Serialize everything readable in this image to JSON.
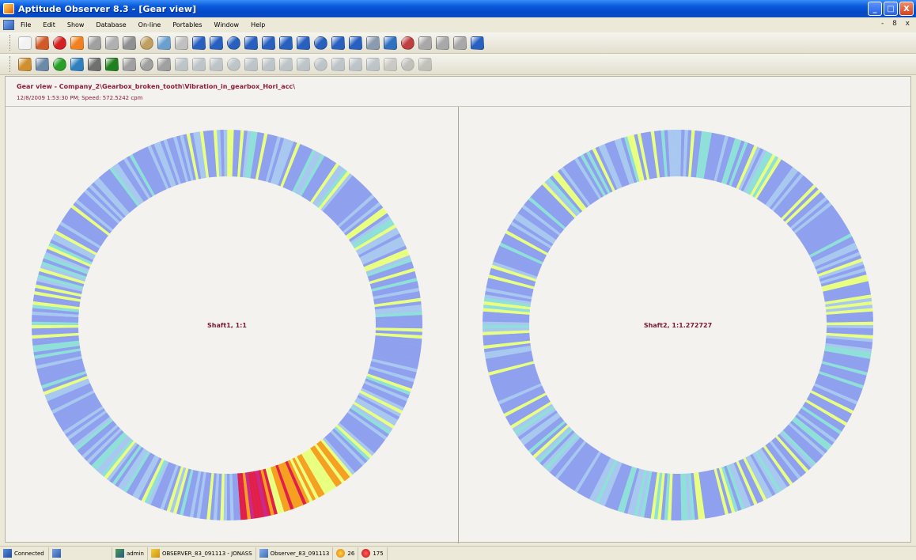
{
  "window": {
    "title": "Aptitude Observer 8.3 - [Gear view]",
    "controls": [
      "_",
      "□",
      "X"
    ]
  },
  "menu": {
    "items": [
      "File",
      "Edit",
      "Show",
      "Database",
      "On-line",
      "Portables",
      "Window",
      "Help"
    ],
    "mdi_controls": "- 8 x"
  },
  "toolbar1": {
    "buttons": [
      {
        "name": "new-doc-icon",
        "color": "#f2f2f2"
      },
      {
        "name": "edit-icon",
        "color": "#d25a2a"
      },
      {
        "name": "alarm-red-icon",
        "color": "#d42020"
      },
      {
        "name": "alarm-orange-icon",
        "color": "#f08020"
      },
      {
        "name": "tools-icon",
        "color": "#a0a0a0"
      },
      {
        "name": "gear-icon",
        "color": "#b0b0b0"
      },
      {
        "name": "gear2-icon",
        "color": "#909090"
      },
      {
        "name": "machine-icon",
        "color": "#c0a060"
      },
      {
        "name": "chart-icon",
        "color": "#6aa0d0"
      },
      {
        "name": "stopwatch-icon",
        "color": "#c0c0c0"
      },
      {
        "name": "trend-icon",
        "color": "#2860c0"
      },
      {
        "name": "wave-icon",
        "color": "#2860c0"
      },
      {
        "name": "spectrum-icon",
        "color": "#2860c0"
      },
      {
        "name": "list-icon",
        "color": "#2860c0"
      },
      {
        "name": "zoom-icon",
        "color": "#2860c0"
      },
      {
        "name": "cross-icon",
        "color": "#2860c0"
      },
      {
        "name": "orbit-icon",
        "color": "#2860c0"
      },
      {
        "name": "polar-icon",
        "color": "#2860c0"
      },
      {
        "name": "circle-icon",
        "color": "#2860c0"
      },
      {
        "name": "line-icon",
        "color": "#2860c0"
      },
      {
        "name": "waterfall-icon",
        "color": "#8a9ab0"
      },
      {
        "name": "map-icon",
        "color": "#3070c0"
      },
      {
        "name": "bar-icon",
        "color": "#c04040"
      },
      {
        "name": "grey1-icon",
        "color": "#a8a8a8"
      },
      {
        "name": "grey2-icon",
        "color": "#a8a8a8"
      },
      {
        "name": "grey3-icon",
        "color": "#a8a8a8"
      },
      {
        "name": "down-icon",
        "color": "#2860c0"
      }
    ]
  },
  "toolbar2": {
    "buttons": [
      {
        "name": "tree-icon",
        "color": "#d09030"
      },
      {
        "name": "trend-small-icon",
        "color": "#6a8aa8"
      },
      {
        "name": "globe-icon",
        "color": "#28a028"
      },
      {
        "name": "globe2-icon",
        "color": "#3080c0"
      },
      {
        "name": "stack-icon",
        "color": "#707070"
      },
      {
        "name": "recycle-icon",
        "color": "#208020"
      },
      {
        "name": "stopwatch2-icon",
        "color": "#a0a0a0"
      },
      {
        "name": "stopwatch3-icon",
        "color": "#a0a0a0"
      },
      {
        "name": "stopwatch4-icon",
        "color": "#a0a0a0"
      },
      {
        "name": "grey-a-icon",
        "color": "#9aa8b8"
      },
      {
        "name": "grey-b-icon",
        "color": "#9aa8b8"
      },
      {
        "name": "grey-c-icon",
        "color": "#9aa8b8"
      },
      {
        "name": "grey-d-icon",
        "color": "#9aa8b8"
      },
      {
        "name": "grey-e-icon",
        "color": "#9aa8b8"
      },
      {
        "name": "grey-f-icon",
        "color": "#9aa8b8"
      },
      {
        "name": "grey-g-icon",
        "color": "#9aa8b8"
      },
      {
        "name": "grey-h-icon",
        "color": "#9aa8b8"
      },
      {
        "name": "grey-i-icon",
        "color": "#9aa8b8"
      },
      {
        "name": "grey-j-icon",
        "color": "#9aa8b8"
      },
      {
        "name": "grey-k-icon",
        "color": "#9aa8b8"
      },
      {
        "name": "grey-l-icon",
        "color": "#9aa8b8"
      },
      {
        "name": "stop-icon",
        "color": "#b0b0b0"
      },
      {
        "name": "save-icon",
        "color": "#a0a0a0"
      },
      {
        "name": "print-icon",
        "color": "#a0a0a0"
      }
    ]
  },
  "view": {
    "title": "Gear view - Company_2\\Gearbox_broken_tooth\\Vibration_in_gearbox_Hori_acc\\",
    "subtitle": "12/8/2009 1:53:30 PM; Speed: 572.5242 cpm"
  },
  "gears": [
    {
      "label": "Shaft1, 1:1",
      "hot_start_deg": 140,
      "hot_end_deg": 175,
      "hot_peak_deg": 165
    },
    {
      "label": "Shaft2, 1:1.272727",
      "hot_start_deg": null,
      "hot_end_deg": null,
      "hot_peak_deg": null
    }
  ],
  "colors": {
    "base_blue": "#8ea0ee",
    "light_blue": "#a8c8f0",
    "cyan": "#8ee0d8",
    "yellow_green": "#e8ff80",
    "orange": "#f5a020",
    "red": "#e0204a",
    "magenta": "#c82890"
  },
  "statusbar": {
    "connection": "Connected",
    "user": "admin",
    "server": "OBSERVER_83_091113 - JONASS",
    "database": "Observer_83_091113",
    "count_a": "26",
    "count_b": "175"
  }
}
